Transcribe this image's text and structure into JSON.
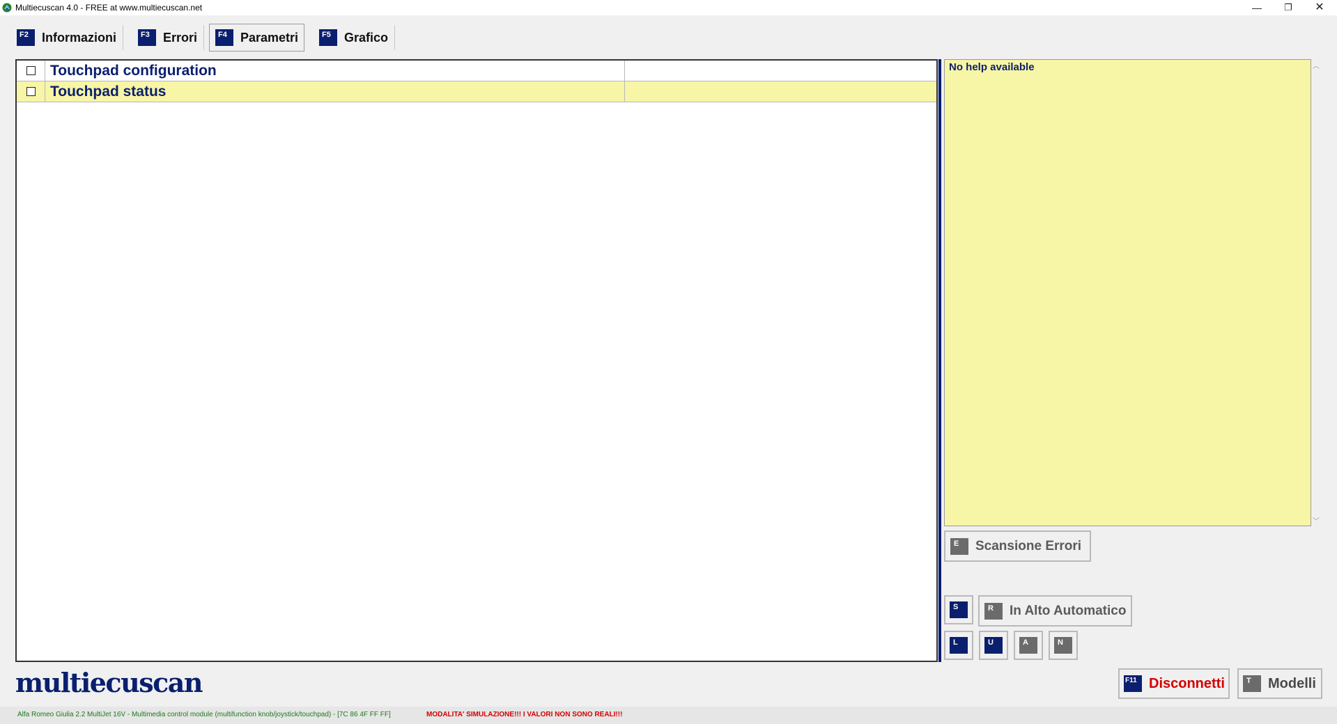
{
  "window": {
    "title": "Multiecuscan 4.0 - FREE at www.multiecuscan.net",
    "minimize": "—",
    "restore": "❐",
    "close": "✕"
  },
  "tabs": [
    {
      "key": "F2",
      "label": "Informazioni",
      "active": false
    },
    {
      "key": "F3",
      "label": "Errori",
      "active": false
    },
    {
      "key": "F4",
      "label": "Parametri",
      "active": true
    },
    {
      "key": "F5",
      "label": "Grafico",
      "active": false
    }
  ],
  "parameters": [
    {
      "name": "Touchpad configuration",
      "value": "",
      "checked": false
    },
    {
      "name": "Touchpad status",
      "value": "",
      "checked": false
    }
  ],
  "help": {
    "text": "No help available",
    "scroll_up": "︿",
    "scroll_down": "﹀"
  },
  "buttons": {
    "scan": {
      "key": "E",
      "label": "Scansione Errori"
    },
    "s": {
      "key": "S"
    },
    "inalto": {
      "key": "R",
      "label": "In Alto Automatico"
    },
    "l": {
      "key": "L"
    },
    "u": {
      "key": "U"
    },
    "a": {
      "key": "A"
    },
    "n": {
      "key": "N"
    },
    "disconnect": {
      "key": "F11",
      "label": "Disconnetti"
    },
    "models": {
      "key": "T",
      "label": "Modelli"
    }
  },
  "logo": "multiecuscan",
  "status": {
    "vehicle": "Alfa Romeo Giulia 2.2 MultiJet 16V - Multimedia control module (multifunction knob/joystick/touchpad) - [7C 86 4F FF FF]",
    "simulation": "MODALITA' SIMULAZIONE!!! I VALORI NON SONO REALI!!!"
  },
  "colors": {
    "accent": "#0a1f6e",
    "help_bg": "#f7f5a6",
    "warning": "#d40000",
    "vehicle_text": "#1a7a1a"
  }
}
